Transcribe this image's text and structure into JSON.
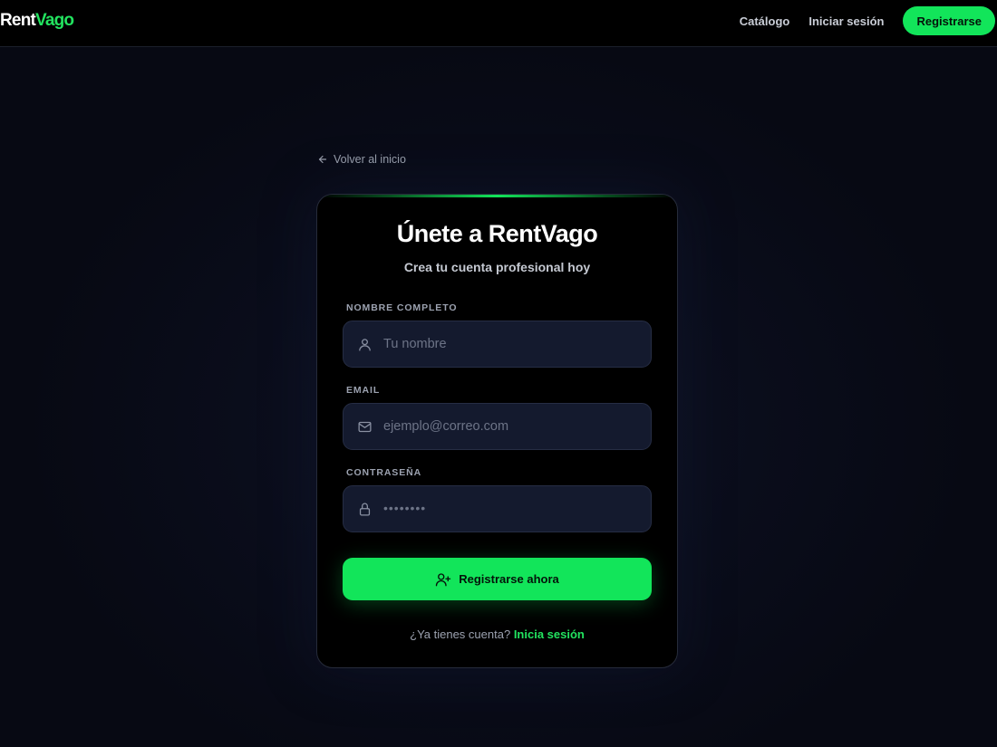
{
  "brand": {
    "part1": "Rent",
    "part2": "Vago",
    "accent": "#12e55a"
  },
  "nav": {
    "catalog": "Catálogo",
    "login": "Iniciar sesión",
    "register": "Registrarse"
  },
  "back_link": {
    "label": "Volver al inicio",
    "icon": "arrow-left-icon"
  },
  "card": {
    "title": "Únete a RentVago",
    "subtitle": "Crea tu cuenta profesional hoy"
  },
  "form": {
    "name": {
      "label": "NOMBRE COMPLETO",
      "placeholder": "Tu nombre",
      "value": "",
      "icon": "user-icon"
    },
    "email": {
      "label": "EMAIL",
      "placeholder": "ejemplo@correo.com",
      "value": "",
      "icon": "mail-icon"
    },
    "password": {
      "label": "CONTRASEÑA",
      "placeholder": "••••••••",
      "value": "",
      "icon": "lock-icon"
    },
    "submit": {
      "label": "Registrarse ahora",
      "icon": "user-plus-icon"
    }
  },
  "footer": {
    "prompt": "¿Ya tienes cuenta?",
    "link": "Inicia sesión"
  }
}
